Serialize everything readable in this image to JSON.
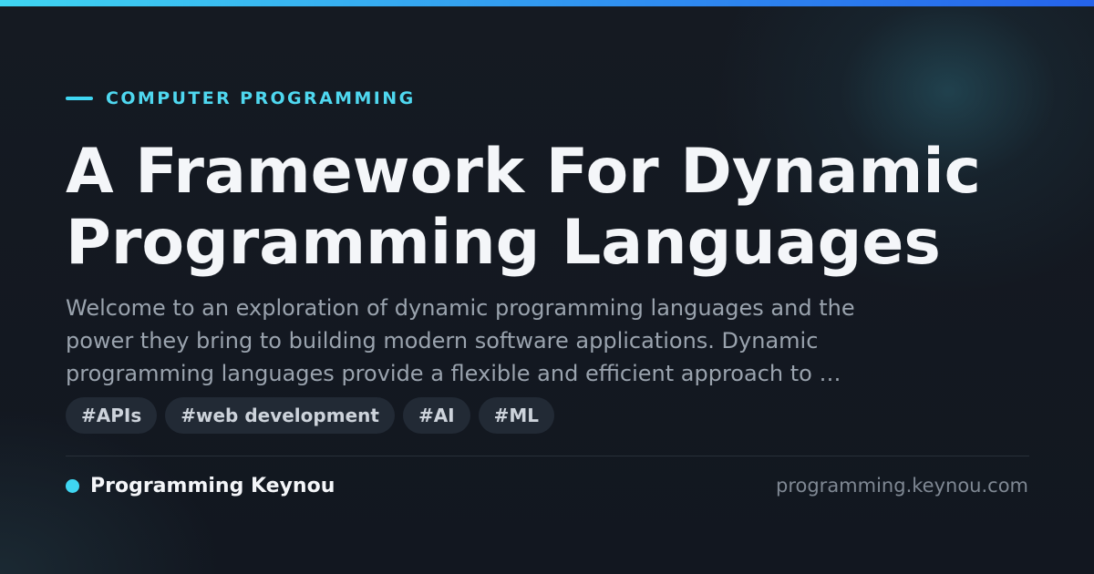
{
  "category": "COMPUTER PROGRAMMING",
  "title_lines": [
    "A Framework For Dynamic",
    "Programming Languages"
  ],
  "description_lines": [
    "Welcome to an exploration of dynamic programming languages and the",
    "power they bring to building modern software applications. Dynamic",
    "programming languages provide a flexible and efficient approach to …"
  ],
  "tags": [
    "#APIs",
    "#web development",
    "#AI",
    "#ML"
  ],
  "brand": {
    "name": "Programming Keynou",
    "domain": "programming.keynou.com"
  },
  "colors": {
    "accent": "#3fd6f2",
    "background": "#131820",
    "tag_background": "#222a35",
    "title": "#f4f6f9",
    "description": "#9aa3ae",
    "domain": "#7f8893"
  }
}
